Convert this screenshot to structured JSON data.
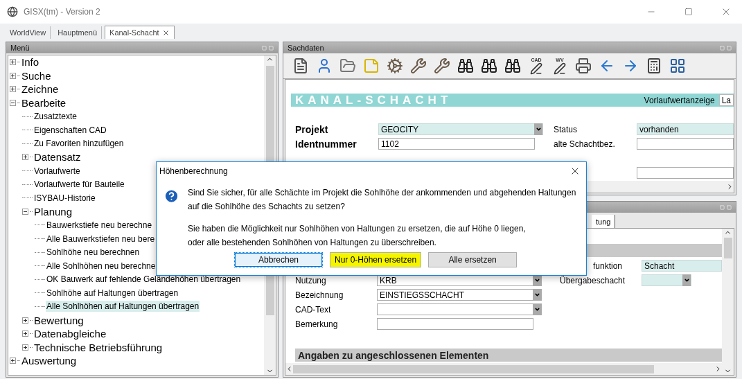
{
  "window": {
    "title": "GISX(tm) - Version 2"
  },
  "tabs": [
    {
      "label": "WorldView",
      "selected": false,
      "closable": false
    },
    {
      "label": "Hauptmenü",
      "selected": false,
      "closable": false
    },
    {
      "label": "Kanal-Schacht",
      "selected": true,
      "closable": true
    }
  ],
  "menu_panel": {
    "title": "Menü",
    "tree": [
      {
        "label": "Info",
        "expanded": false,
        "selected": false
      },
      {
        "label": "Suche",
        "expanded": false,
        "selected": false
      },
      {
        "label": "Zeichne",
        "expanded": false,
        "selected": false
      },
      {
        "label": "Bearbeite",
        "expanded": true,
        "selected": false,
        "children": [
          {
            "label": "Zusatztexte",
            "selected": false
          },
          {
            "label": "Eigenschaften CAD",
            "selected": false
          },
          {
            "label": "Zu Favoriten hinzufügen",
            "selected": false
          },
          {
            "label": "Datensatz",
            "expanded": false,
            "selected": false
          },
          {
            "label": "Vorlaufwerte",
            "selected": false
          },
          {
            "label": "Vorlaufwerte für Bauteile",
            "selected": false
          },
          {
            "label": "ISYBAU-Historie",
            "selected": false
          },
          {
            "label": "Planung",
            "expanded": true,
            "selected": false,
            "children": [
              {
                "label": "Bauwerkstiefe neu berechne",
                "selected": false
              },
              {
                "label": "Alle Bauwerkstiefen neu bere",
                "selected": false
              },
              {
                "label": "Sohlhöhe neu berechnen",
                "selected": false
              },
              {
                "label": "Alle Sohlhöhen neu berechne",
                "selected": false
              },
              {
                "label": "OK Bauwerk auf fehlende Geländehöhen übertragen",
                "selected": false
              },
              {
                "label": "Sohlhöhe auf Haltungen übertragen",
                "selected": false
              },
              {
                "label": "Alle Sohlhöhen auf Haltungen übertragen",
                "selected": true
              }
            ]
          },
          {
            "label": "Bewertung",
            "expanded": false,
            "selected": false
          },
          {
            "label": "Datenabgleiche",
            "expanded": false,
            "selected": false
          },
          {
            "label": "Technische Betriebsführung",
            "expanded": false,
            "selected": false
          }
        ]
      },
      {
        "label": "Auswertung",
        "expanded": false,
        "selected": false
      }
    ]
  },
  "data_panel": {
    "title": "Sachdaten",
    "toolbar": [
      {
        "kind": "info"
      },
      {
        "kind": "user"
      },
      {
        "kind": "folder"
      },
      {
        "kind": "note"
      },
      {
        "kind": "gear"
      },
      {
        "kind": "wrench"
      },
      {
        "kind": "wrench"
      },
      {
        "kind": "binoculars"
      },
      {
        "kind": "binoculars"
      },
      {
        "kind": "binoculars"
      },
      {
        "kind": "pen",
        "caption": "CAD"
      },
      {
        "kind": "pen",
        "caption": "WV"
      },
      {
        "kind": "printer"
      },
      {
        "kind": "back"
      },
      {
        "kind": "forward"
      },
      {
        "kind": "calculator"
      },
      {
        "kind": "table"
      }
    ],
    "form_title": "KANAL-SCHACHT",
    "preview_label": "Vorlaufwertanzeige",
    "preview_value": "La",
    "left_fields": [
      {
        "label": "Projekt",
        "kind": "dropdown",
        "value": "GEOCITY",
        "mandatory": true
      },
      {
        "label": "Identnummer",
        "kind": "input",
        "value": "1102",
        "mandatory": false
      }
    ],
    "right_fields": [
      {
        "label": "Status",
        "value": "vorhanden",
        "mandatory": true
      },
      {
        "label": "alte Schachtbez.",
        "mandatory": false
      },
      {
        "mandatory": false
      }
    ]
  },
  "detail_panel": {
    "tabs": [
      {
        "label": "tung",
        "selected": true
      }
    ],
    "right_fields": [
      {
        "label": "funktion",
        "kind": "input",
        "value": "Schacht",
        "mandatory": true
      },
      {
        "label": "Übergabeschacht",
        "kind": "dropdown",
        "mandatory": true
      }
    ],
    "left_fields": [
      {
        "label": "Nutzung",
        "kind": "dropdown",
        "value": "KRB",
        "mandatory": false
      },
      {
        "label": "Bezeichnung",
        "kind": "dropdown",
        "value": "EINSTIEGSSCHACHT",
        "mandatory": false
      },
      {
        "label": "CAD-Text",
        "kind": "dropdown",
        "mandatory": false
      },
      {
        "label": "Bemerkung",
        "kind": "input",
        "mandatory": false
      }
    ],
    "section": "Angaben zu angeschlossenen Elementen"
  },
  "dialog": {
    "title": "Höhenberechnung",
    "message": [
      "Sind Sie sicher, für alle Schächte im Projekt die Sohlhöhe der ankommenden und abgehenden Haltungen auf die Sohlhöhe des Schachts zu setzen?",
      "Sie haben die Möglichkeit nur Sohlhöhen von Haltungen zu ersetzen, die auf Höhe 0 liegen,\noder alle bestehenden Sohlhöhen von Haltungen zu überschreiben."
    ],
    "buttons": [
      {
        "label": "Abbrechen",
        "focused": true,
        "highlighted": false
      },
      {
        "label": "Nur 0-Höhen ersetzen",
        "focused": false,
        "highlighted": true
      },
      {
        "label": "Alle ersetzen",
        "focused": false,
        "highlighted": false
      }
    ]
  }
}
